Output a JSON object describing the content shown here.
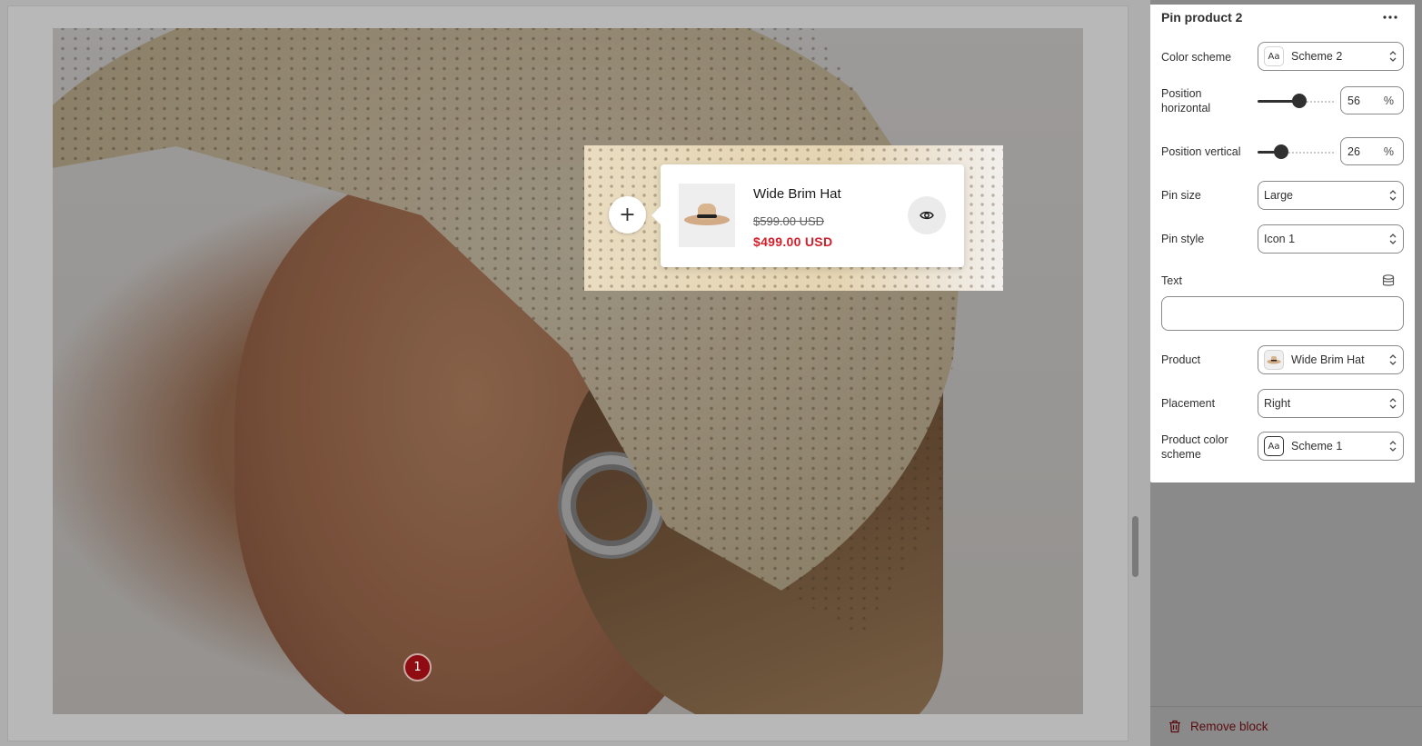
{
  "preview": {
    "pin_number": "1",
    "product_popup": {
      "plus_symbol": "+",
      "title": "Wide Brim Hat",
      "compare_price": "$599.00 USD",
      "price": "$499.00 USD",
      "quick_view_icon": "eye-icon"
    }
  },
  "panel": {
    "title": "Pin product 2",
    "more_icon": "more-horizontal-icon",
    "color_scheme": {
      "label": "Color scheme",
      "value": "Scheme 2",
      "icon": "Aa"
    },
    "position_horizontal": {
      "label": "Position horizontal",
      "value": "56",
      "unit": "%",
      "percent": 56
    },
    "position_vertical": {
      "label": "Position vertical",
      "value": "26",
      "unit": "%",
      "percent": 26
    },
    "pin_size": {
      "label": "Pin size",
      "value": "Large"
    },
    "pin_style": {
      "label": "Pin style",
      "value": "Icon 1"
    },
    "text": {
      "label": "Text",
      "value": "",
      "icon": "database-icon"
    },
    "product": {
      "label": "Product",
      "value": "Wide Brim Hat"
    },
    "placement": {
      "label": "Placement",
      "value": "Right"
    },
    "product_color_scheme": {
      "label": "Product color scheme",
      "value": "Scheme 1",
      "icon": "Aa"
    },
    "remove_block": "Remove block"
  },
  "colors": {
    "pin_dot": "#8e0c12",
    "price_sale": "#d1202d",
    "remove": "#5a0b10"
  }
}
